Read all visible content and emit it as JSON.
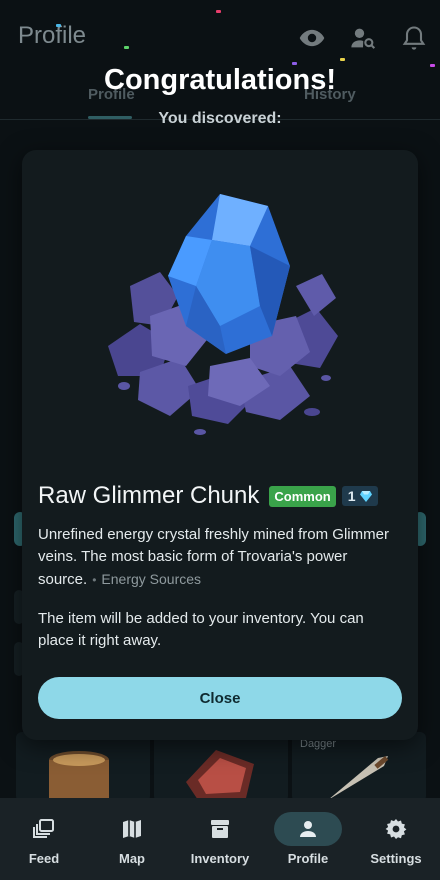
{
  "header": {
    "title": "Profile",
    "icons": [
      "eye-icon",
      "user-search-icon",
      "bell-icon"
    ]
  },
  "tabs": [
    {
      "label": "Profile",
      "active": true
    },
    {
      "label": "History",
      "active": false
    }
  ],
  "background_cards": [
    {
      "label": ""
    },
    {
      "label": ""
    },
    {
      "label": "Dagger"
    }
  ],
  "dialog": {
    "heading": "Congratulations!",
    "subheading": "You discovered:",
    "item": {
      "name": "Raw Glimmer Chunk",
      "rarity": "Common",
      "level": "1",
      "description": "Unrefined energy crystal freshly mined from Glimmer veins. The most basic form of Trovaria's power source.",
      "category": "Energy Sources"
    },
    "note": "The item will be added to your inventory. You can place it right away.",
    "close_label": "Close"
  },
  "colors": {
    "rarity_common": "#3aa34a",
    "close_button": "#8ed8e8",
    "active_nav": "#2d4b52"
  },
  "nav": {
    "items": [
      {
        "label": "Feed",
        "icon": "feed-icon",
        "active": false
      },
      {
        "label": "Map",
        "icon": "map-icon",
        "active": false
      },
      {
        "label": "Inventory",
        "icon": "inventory-icon",
        "active": false
      },
      {
        "label": "Profile",
        "icon": "profile-icon",
        "active": true
      },
      {
        "label": "Settings",
        "icon": "settings-icon",
        "active": false
      }
    ]
  }
}
